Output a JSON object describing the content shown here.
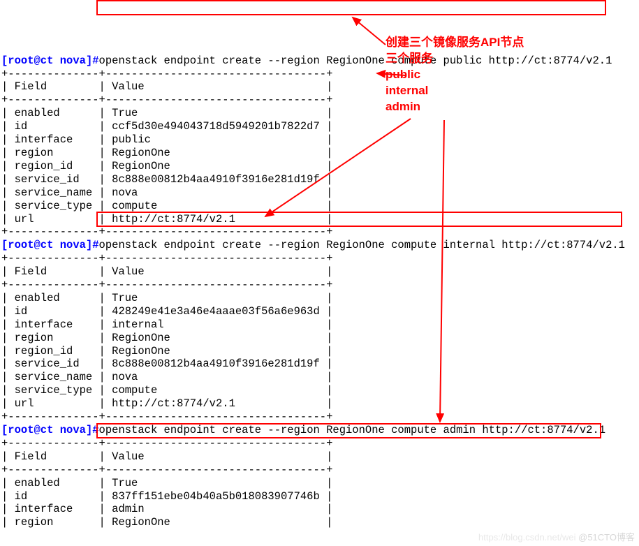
{
  "prompts": {
    "root": "[root@ct ",
    "path": "nova",
    "end": "]#"
  },
  "commands": {
    "public": "openstack endpoint create --region RegionOne compute public http://ct:8774/v2.1",
    "internal": "openstack endpoint create --region RegionOne compute internal http://ct:8774/v2.1",
    "admin": "openstack endpoint create --region RegionOne compute admin http://ct:8774/v2.1"
  },
  "tables": {
    "header": {
      "field": "Field",
      "value": "Value"
    },
    "sep": "+--------------+----------------------------------+",
    "hdrRow": "| Field        | Value                            |",
    "public": {
      "enabled": "True",
      "id": "ccf5d30e494043718d5949201b7822d7",
      "interface": "public",
      "region": "RegionOne",
      "region_id": "RegionOne",
      "service_id": "8c888e00812b4aa4910f3916e281d19f",
      "service_name": "nova",
      "service_type": "compute",
      "url": "http://ct:8774/v2.1"
    },
    "internal": {
      "enabled": "True",
      "id": "428249e41e3a46e4aaae03f56a6e963d",
      "interface": "internal",
      "region": "RegionOne",
      "region_id": "RegionOne",
      "service_id": "8c888e00812b4aa4910f3916e281d19f",
      "service_name": "nova",
      "service_type": "compute",
      "url": "http://ct:8774/v2.1"
    },
    "admin": {
      "enabled": "True",
      "id": "837ff151ebe04b40a5b018083907746b",
      "interface": "admin",
      "region": "RegionOne"
    }
  },
  "annotation": {
    "line1": "创建三个镜像服务API节点",
    "line2": "三个服务",
    "line3": "public",
    "line4": "internal",
    "line5": "admin"
  },
  "watermark": "@51CTO博客"
}
